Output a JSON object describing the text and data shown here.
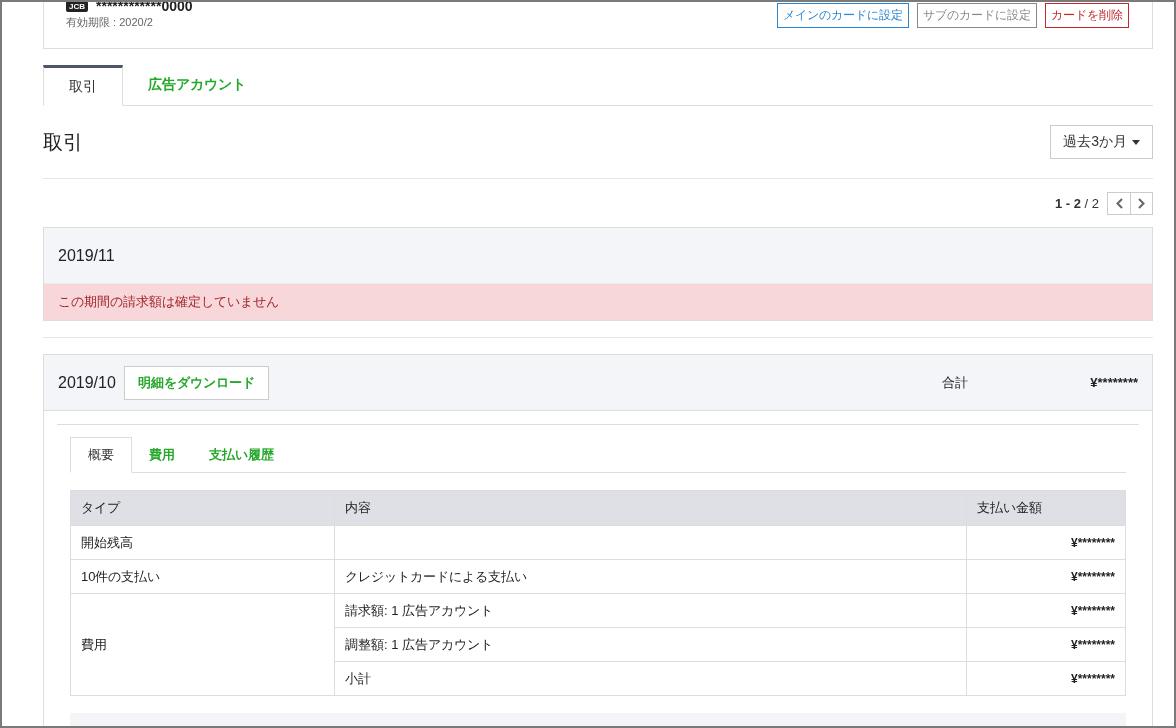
{
  "card": {
    "brand": "JCB",
    "number": "************0000",
    "expiry": "有効期限 : 2020/2",
    "actions": [
      {
        "label": "メインのカードに設定",
        "kind": "primary"
      },
      {
        "label": "サブのカードに設定",
        "kind": "secondary"
      },
      {
        "label": "カードを削除",
        "kind": "danger"
      }
    ]
  },
  "tabs": [
    {
      "label": "取引",
      "selected": true
    },
    {
      "label": "広告アカウント",
      "selected": false
    }
  ],
  "heading": "取引",
  "period_dropdown": {
    "value": "過去3か月"
  },
  "pagination": {
    "range": "1 - 2",
    "total": "/ 2"
  },
  "periods": [
    {
      "month": "2019/11",
      "alert": "この期間の請求額は確定していません"
    },
    {
      "month": "2019/10",
      "download": "明細をダウンロード",
      "total_label": "合計",
      "total": "¥********",
      "tabs": [
        {
          "label": "概要",
          "selected": true
        },
        {
          "label": "費用",
          "selected": false
        },
        {
          "label": "支払い履歴",
          "selected": false
        }
      ],
      "table": {
        "columns": [
          "タイプ",
          "内容",
          "支払い金額"
        ],
        "rows": [
          {
            "type": "開始残高",
            "lines": [
              {
                "amount": "¥********"
              }
            ]
          },
          {
            "type": "10件の支払い",
            "lines": [
              {
                "content": "クレジットカードによる支払い",
                "amount": "¥********"
              }
            ]
          },
          {
            "type": "費用",
            "lines": [
              {
                "content": "請求額: 1 広告アカウント",
                "amount": "¥********"
              },
              {
                "content": "調整額: 1 広告アカウント",
                "amount": "¥********"
              },
              {
                "content": "小計",
                "amount": "¥********"
              }
            ]
          }
        ]
      }
    }
  ]
}
